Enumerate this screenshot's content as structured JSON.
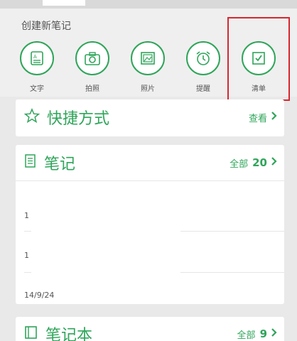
{
  "create": {
    "title": "创建新笔记",
    "buttons": [
      {
        "label": "文字",
        "icon": "text-note-icon"
      },
      {
        "label": "拍照",
        "icon": "camera-icon"
      },
      {
        "label": "照片",
        "icon": "photo-icon"
      },
      {
        "label": "提醒",
        "icon": "alarm-clock-icon"
      },
      {
        "label": "清单",
        "icon": "checklist-icon"
      }
    ]
  },
  "shortcuts": {
    "title": "快捷方式",
    "action": "查看"
  },
  "notes": {
    "title": "笔记",
    "action": "全部",
    "count": "20",
    "rows": [
      {
        "date": "1"
      },
      {
        "date": "1"
      },
      {
        "date": "14/9/24"
      }
    ]
  },
  "notebooks": {
    "title": "笔记本",
    "action": "全部",
    "count": "9"
  },
  "colors": {
    "accent": "#2fa55a",
    "highlight": "#d9262f"
  }
}
